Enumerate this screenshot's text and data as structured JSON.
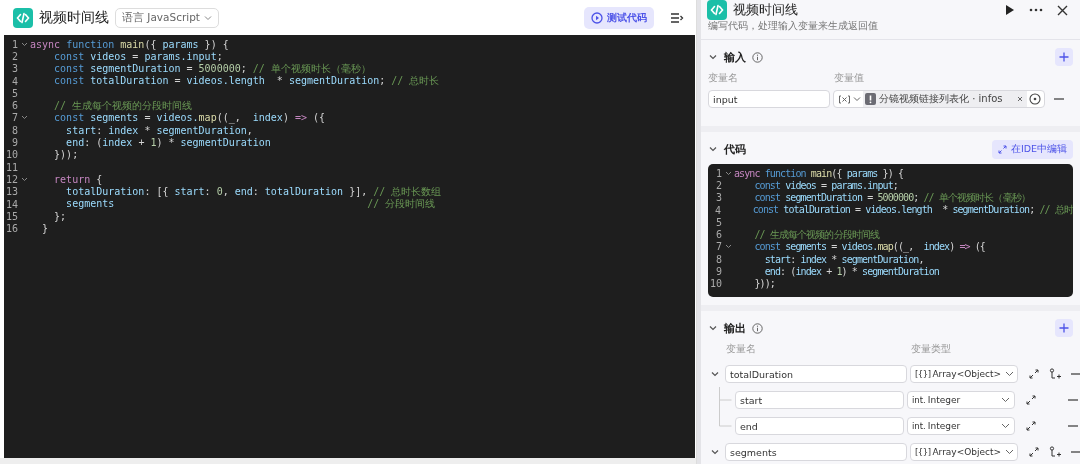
{
  "editor": {
    "title": "视频时间线",
    "language": "语言 JavaScript",
    "test_button": "测试代码",
    "lines": [
      {
        "number": "1",
        "foldable": true,
        "tokens": [
          {
            "kind": "kw2",
            "text": "async "
          },
          {
            "kind": "kw",
            "text": "function "
          },
          {
            "kind": "fn",
            "text": "main"
          },
          {
            "kind": "plain",
            "text": "({ "
          },
          {
            "kind": "var",
            "text": "params"
          },
          {
            "kind": "plain",
            "text": " }) {"
          }
        ]
      },
      {
        "number": "2",
        "foldable": false,
        "tokens": [
          {
            "kind": "kw",
            "text": "    const"
          },
          {
            "kind": "var",
            "text": " videos"
          },
          {
            "kind": "plain",
            "text": " = "
          },
          {
            "kind": "var",
            "text": "params.input"
          },
          {
            "kind": "plain",
            "text": ";"
          }
        ]
      },
      {
        "number": "3",
        "foldable": false,
        "tokens": [
          {
            "kind": "kw",
            "text": "    const"
          },
          {
            "kind": "var",
            "text": " segmentDuration"
          },
          {
            "kind": "plain",
            "text": " = "
          },
          {
            "kind": "num",
            "text": "5000000"
          },
          {
            "kind": "plain",
            "text": "; "
          },
          {
            "kind": "cm",
            "text": "// 单个视频时长（毫秒）"
          }
        ]
      },
      {
        "number": "4",
        "foldable": false,
        "tokens": [
          {
            "kind": "kw",
            "text": "    const"
          },
          {
            "kind": "var",
            "text": " totalDuration"
          },
          {
            "kind": "plain",
            "text": " = "
          },
          {
            "kind": "var",
            "text": "videos.length"
          },
          {
            "kind": "plain",
            "text": "  * "
          },
          {
            "kind": "var",
            "text": "segmentDuration"
          },
          {
            "kind": "plain",
            "text": "; "
          },
          {
            "kind": "cm",
            "text": "// 总时长"
          }
        ]
      },
      {
        "number": "5",
        "foldable": false
      },
      {
        "number": "6",
        "foldable": false,
        "tokens": [
          {
            "kind": "cm",
            "text": "    // 生成每个视频的分段时间线"
          }
        ]
      },
      {
        "number": "7",
        "foldable": true,
        "tokens": [
          {
            "kind": "kw",
            "text": "    const"
          },
          {
            "kind": "var",
            "text": " segments"
          },
          {
            "kind": "plain",
            "text": " = "
          },
          {
            "kind": "var",
            "text": "videos."
          },
          {
            "kind": "fn",
            "text": "map"
          },
          {
            "kind": "plain",
            "text": "((_,  "
          },
          {
            "kind": "var",
            "text": "index"
          },
          {
            "kind": "plain",
            "text": ") "
          },
          {
            "kind": "kw2",
            "text": "=>"
          },
          {
            "kind": "plain",
            "text": " ({"
          }
        ]
      },
      {
        "number": "8",
        "foldable": false,
        "tokens": [
          {
            "kind": "var",
            "text": "      start"
          },
          {
            "kind": "plain",
            "text": ": "
          },
          {
            "kind": "var",
            "text": "index"
          },
          {
            "kind": "plain",
            "text": " * "
          },
          {
            "kind": "var",
            "text": "segmentDuration"
          },
          {
            "kind": "plain",
            "text": ","
          }
        ]
      },
      {
        "number": "9",
        "foldable": false,
        "tokens": [
          {
            "kind": "var",
            "text": "      end"
          },
          {
            "kind": "plain",
            "text": ": ("
          },
          {
            "kind": "var",
            "text": "index"
          },
          {
            "kind": "plain",
            "text": " + "
          },
          {
            "kind": "num",
            "text": "1"
          },
          {
            "kind": "plain",
            "text": ") * "
          },
          {
            "kind": "var",
            "text": "segmentDuration"
          }
        ]
      },
      {
        "number": "10",
        "foldable": false,
        "tokens": [
          {
            "kind": "plain",
            "text": "    }));"
          }
        ]
      },
      {
        "number": "11",
        "foldable": false
      },
      {
        "number": "12",
        "foldable": true,
        "tokens": [
          {
            "kind": "kw2",
            "text": "    return"
          },
          {
            "kind": "plain",
            "text": " {"
          }
        ]
      },
      {
        "number": "13",
        "foldable": false,
        "tokens": [
          {
            "kind": "var",
            "text": "      totalDuration"
          },
          {
            "kind": "plain",
            "text": ": [{ "
          },
          {
            "kind": "var",
            "text": "start"
          },
          {
            "kind": "plain",
            "text": ": "
          },
          {
            "kind": "num",
            "text": "0"
          },
          {
            "kind": "plain",
            "text": ", "
          },
          {
            "kind": "var",
            "text": "end"
          },
          {
            "kind": "plain",
            "text": ": "
          },
          {
            "kind": "var",
            "text": "totalDuration"
          },
          {
            "kind": "plain",
            "text": " }], "
          },
          {
            "kind": "cm",
            "text": "// 总时长数组"
          }
        ]
      },
      {
        "number": "14",
        "foldable": false,
        "tokens": [
          {
            "kind": "var",
            "text": "      segments"
          },
          {
            "kind": "cm",
            "text": "                                          // 分段时间线"
          }
        ]
      },
      {
        "number": "15",
        "foldable": false,
        "tokens": [
          {
            "kind": "plain",
            "text": "    };"
          }
        ]
      },
      {
        "number": "16",
        "foldable": false,
        "tokens": [
          {
            "kind": "plain",
            "text": "  }"
          }
        ]
      }
    ]
  },
  "node_panel": {
    "title": "视频时间线",
    "description": "编写代码，处理输入变量来生成返回值",
    "input": {
      "title": "输入",
      "expanded": true,
      "columns": [
        "变量名",
        "变量值"
      ],
      "rows": [
        {
          "name": "input",
          "reference": "分镜视频链接列表化 · infos"
        }
      ]
    },
    "code": {
      "title": "代码",
      "expanded": true,
      "ide_button": "在IDE中编辑",
      "lines": [
        {
          "number": "1",
          "foldable": true,
          "tokens": [
            {
              "kind": "kw2",
              "text": "async "
            },
            {
              "kind": "kw",
              "text": "function "
            },
            {
              "kind": "fn",
              "text": "main"
            },
            {
              "kind": "plain",
              "text": "({ "
            },
            {
              "kind": "var",
              "text": "params"
            },
            {
              "kind": "plain",
              "text": " }) {"
            }
          ]
        },
        {
          "number": "2",
          "foldable": false,
          "tokens": [
            {
              "kind": "kw",
              "text": "    const"
            },
            {
              "kind": "var",
              "text": " videos"
            },
            {
              "kind": "plain",
              "text": " = "
            },
            {
              "kind": "var",
              "text": "params.input"
            },
            {
              "kind": "plain",
              "text": ";"
            }
          ]
        },
        {
          "number": "3",
          "foldable": false,
          "tokens": [
            {
              "kind": "kw",
              "text": "    const"
            },
            {
              "kind": "var",
              "text": " segmentDuration"
            },
            {
              "kind": "plain",
              "text": " = "
            },
            {
              "kind": "num",
              "text": "5000000"
            },
            {
              "kind": "plain",
              "text": "; "
            },
            {
              "kind": "cm",
              "text": "// 单个视频时长（毫秒）"
            }
          ]
        },
        {
          "number": "4",
          "foldable": false,
          "tokens": [
            {
              "kind": "kw",
              "text": "    const"
            },
            {
              "kind": "var",
              "text": " totalDuration"
            },
            {
              "kind": "plain",
              "text": " = "
            },
            {
              "kind": "var",
              "text": "videos.length"
            },
            {
              "kind": "plain",
              "text": "  * "
            },
            {
              "kind": "var",
              "text": "segmentDuration"
            },
            {
              "kind": "plain",
              "text": "; "
            },
            {
              "kind": "cm",
              "text": "// 总时"
            }
          ]
        },
        {
          "number": "5",
          "foldable": false
        },
        {
          "number": "6",
          "foldable": false,
          "tokens": [
            {
              "kind": "cm",
              "text": "    // 生成每个视频的分段时间线"
            }
          ]
        },
        {
          "number": "7",
          "foldable": true,
          "tokens": [
            {
              "kind": "kw",
              "text": "    const"
            },
            {
              "kind": "var",
              "text": " segments"
            },
            {
              "kind": "plain",
              "text": " = "
            },
            {
              "kind": "var",
              "text": "videos."
            },
            {
              "kind": "fn",
              "text": "map"
            },
            {
              "kind": "plain",
              "text": "((_,  "
            },
            {
              "kind": "var",
              "text": "index"
            },
            {
              "kind": "plain",
              "text": ") "
            },
            {
              "kind": "kw2",
              "text": "=>"
            },
            {
              "kind": "plain",
              "text": " ({"
            }
          ]
        },
        {
          "number": "8",
          "foldable": false,
          "tokens": [
            {
              "kind": "var",
              "text": "      start"
            },
            {
              "kind": "plain",
              "text": ": "
            },
            {
              "kind": "var",
              "text": "index"
            },
            {
              "kind": "plain",
              "text": " * "
            },
            {
              "kind": "var",
              "text": "segmentDuration"
            },
            {
              "kind": "plain",
              "text": ","
            }
          ]
        },
        {
          "number": "9",
          "foldable": false,
          "tokens": [
            {
              "kind": "var",
              "text": "      end"
            },
            {
              "kind": "plain",
              "text": ": ("
            },
            {
              "kind": "var",
              "text": "index"
            },
            {
              "kind": "plain",
              "text": " + "
            },
            {
              "kind": "num",
              "text": "1"
            },
            {
              "kind": "plain",
              "text": ") * "
            },
            {
              "kind": "var",
              "text": "segmentDuration"
            }
          ]
        },
        {
          "number": "10",
          "foldable": false,
          "tokens": [
            {
              "kind": "plain",
              "text": "    }));"
            }
          ]
        }
      ]
    },
    "output": {
      "title": "输出",
      "expanded": true,
      "columns": [
        "变量名",
        "变量类型"
      ],
      "rows": [
        {
          "name": "totalDuration",
          "kind": "array",
          "type_prefix": "[{}]",
          "type": "Array<Object>",
          "expanded": true,
          "children": [
            {
              "name": "start",
              "kind": "integer",
              "type_prefix": "int.",
              "type": "Integer"
            },
            {
              "name": "end",
              "kind": "integer",
              "type_prefix": "int.",
              "type": "Integer"
            }
          ]
        },
        {
          "name": "segments",
          "kind": "array",
          "type_prefix": "[{}]",
          "type": "Array<Object>",
          "expanded": true
        }
      ]
    }
  }
}
